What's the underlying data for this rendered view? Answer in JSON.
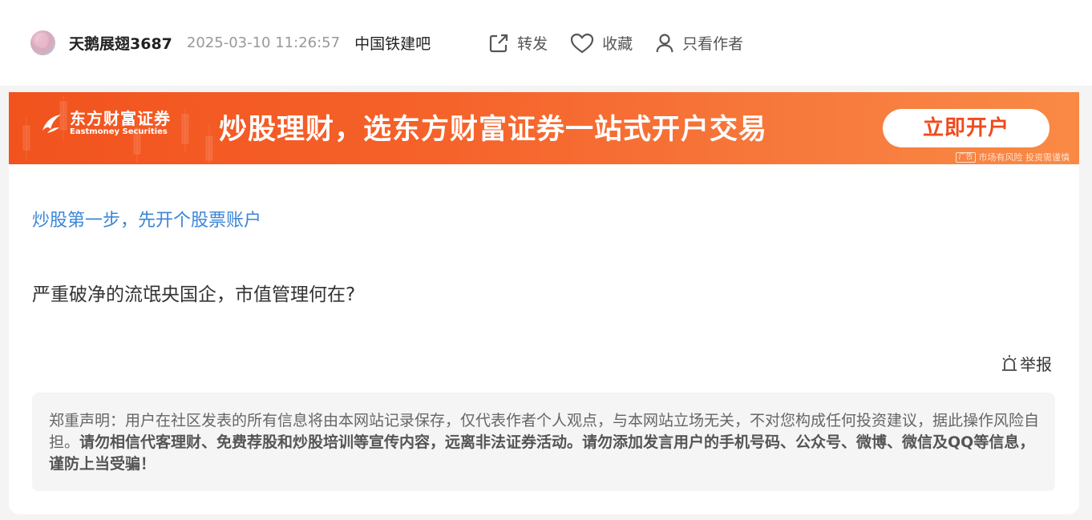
{
  "header": {
    "username": "天鹅展翅3687",
    "time": "2025-03-10 11:26:57",
    "forum": "中国铁建吧",
    "actions": [
      {
        "label": "转发",
        "icon": "share-icon"
      },
      {
        "label": "收藏",
        "icon": "heart-icon"
      },
      {
        "label": "只看作者",
        "icon": "user-icon"
      }
    ]
  },
  "ad": {
    "brand": "东方财富证券",
    "brand_en": "Eastmoney Securities",
    "title": "炒股理财，选东方财富证券一站式开户交易",
    "button": "立即开户",
    "tag": "广告",
    "note": "市场有风险 投资需谨慎",
    "colors": {
      "start": "#f2531e",
      "end": "#f98a45",
      "button_text": "#f04a1c"
    }
  },
  "post": {
    "promo_link": "炒股第一步，先开个股票账户",
    "title": "严重破净的流氓央国企，市值管理何在?",
    "report": "举报"
  },
  "disclaimer": {
    "normal": "郑重声明：用户在社区发表的所有信息将由本网站记录保存，仅代表作者个人观点，与本网站立场无关，不对您构成任何投资建议，据此操作风险自担。",
    "bold": "请勿相信代客理财、免费荐股和炒股培训等宣传内容，远离非法证券活动。请勿添加发言用户的手机号码、公众号、微博、微信及QQ等信息，谨防上当受骗！"
  }
}
